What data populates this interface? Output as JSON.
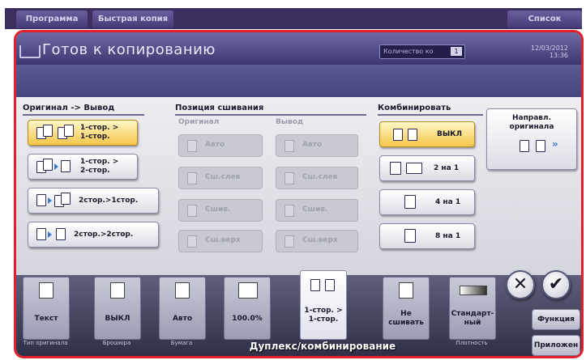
{
  "top_tabs": [
    "Программа",
    "Быстрая копия",
    "Список Заданий"
  ],
  "header": {
    "title": "Готов к копированию",
    "qty_label": "Количество ко",
    "qty_value": "1",
    "date": "12/03/2012",
    "time": "13:36"
  },
  "original_output": {
    "title": "Оригинал -> Вывод",
    "options": [
      {
        "line1": "1-стор. >",
        "line2": "1-стор.",
        "selected": true
      },
      {
        "line1": "1-стор. >",
        "line2": "2-стор.",
        "selected": false
      },
      {
        "line1": "2стор.>1стор.",
        "line2": "",
        "selected": false
      },
      {
        "line1": "2стор.>2стор.",
        "line2": "",
        "selected": false
      }
    ]
  },
  "binding": {
    "title": "Позиция сшивания",
    "original_label": "Оригинал",
    "output_label": "Вывод",
    "original_options": [
      "Авто",
      "Сш.слев",
      "Сшив.",
      "Сш.верх"
    ],
    "output_options": [
      "Авто",
      "Сш.слев",
      "Сшив.",
      "Сш.верх"
    ]
  },
  "combine": {
    "title": "Комбинировать",
    "options": [
      {
        "label": "ВЫКЛ",
        "selected": true
      },
      {
        "label": "2 на 1",
        "selected": false
      },
      {
        "label": "4 на 1",
        "selected": false
      },
      {
        "label": "8 на 1",
        "selected": false
      }
    ]
  },
  "direction": {
    "line1": "Направл.",
    "line2": "оригинала",
    "more": "»"
  },
  "bottom_tiles": [
    {
      "label": "Текст",
      "sub": "Тип оригинала"
    },
    {
      "label": "ВЫКЛ",
      "sub": "Брошюра"
    },
    {
      "label": "Авто",
      "sub": "Бумага"
    },
    {
      "label": "100.0%",
      "sub": ""
    },
    {
      "label1": "1-стор. >",
      "label2": "1-стор.",
      "sub": ""
    },
    {
      "label1": "Не",
      "label2": "сшивать",
      "sub": ""
    },
    {
      "label1": "Стандарт-",
      "label2": "ный",
      "sub": "Плотность"
    }
  ],
  "mode_label": "Дуплекс/комбинирование",
  "right_buttons": [
    "Функция",
    "Приложен"
  ],
  "actions": {
    "cancel": "✕",
    "ok": "✔"
  },
  "colors": {
    "accent": "#f5c64a",
    "frame": "#e0202a",
    "header": "#3b3772"
  }
}
